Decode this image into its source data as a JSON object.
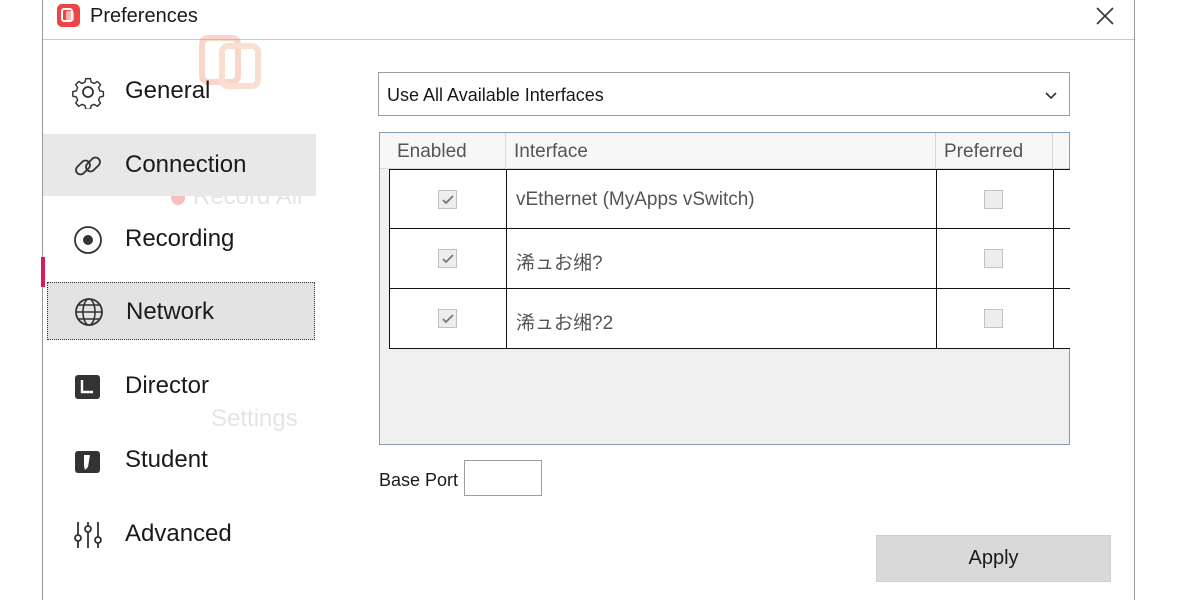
{
  "window": {
    "title": "Preferences"
  },
  "ghost": {
    "record_all": "Record All",
    "settings": "Settings"
  },
  "sidebar": {
    "items": [
      {
        "label": "General",
        "icon": "gear-icon"
      },
      {
        "label": "Connection",
        "icon": "link-icon"
      },
      {
        "label": "Recording",
        "icon": "record-icon"
      },
      {
        "label": "Network",
        "icon": "globe-icon"
      },
      {
        "label": "Director",
        "icon": "director-icon"
      },
      {
        "label": "Student",
        "icon": "student-icon"
      },
      {
        "label": "Advanced",
        "icon": "sliders-icon"
      }
    ],
    "selected": "Network"
  },
  "network": {
    "interface_mode": "Use All Available Interfaces",
    "table": {
      "headers": [
        "Enabled",
        "Interface",
        "Preferred"
      ],
      "rows": [
        {
          "enabled": true,
          "interface": "vEthernet (MyApps vSwitch)",
          "preferred": false
        },
        {
          "enabled": true,
          "interface": "浠ュお缃?",
          "preferred": false
        },
        {
          "enabled": true,
          "interface": "浠ュお缃?2",
          "preferred": false
        }
      ]
    },
    "base_port_label": "Base Port",
    "base_port_value": ""
  },
  "footer": {
    "apply_label": "Apply"
  },
  "colors": {
    "accent": "#d81b60",
    "logo": "#ef4444"
  }
}
